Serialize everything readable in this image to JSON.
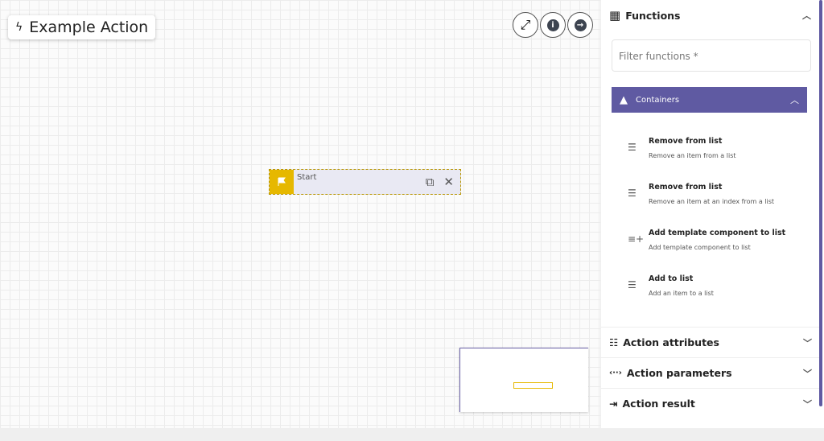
{
  "canvas": {
    "title": "Example Action",
    "node": {
      "label": "Start"
    }
  },
  "panel": {
    "functions": {
      "title": "Functions",
      "filter_placeholder": "Filter functions *",
      "group": {
        "label": "Containers"
      },
      "items": [
        {
          "title": "Remove from list",
          "desc": "Remove an item from a list",
          "icon": "list-icon"
        },
        {
          "title": "Remove from list",
          "desc": "Remove an item at an index from a list",
          "icon": "list-icon"
        },
        {
          "title": "Add template component to list",
          "desc": "Add template component to list",
          "icon": "playlist-add-icon"
        },
        {
          "title": "Add to list",
          "desc": "Add an item to a list",
          "icon": "list-icon"
        }
      ]
    },
    "sections": [
      {
        "title": "Action attributes"
      },
      {
        "title": "Action parameters"
      },
      {
        "title": "Action result"
      }
    ]
  },
  "colors": {
    "accent": "#5f5aa2",
    "node": "#e6b800"
  }
}
